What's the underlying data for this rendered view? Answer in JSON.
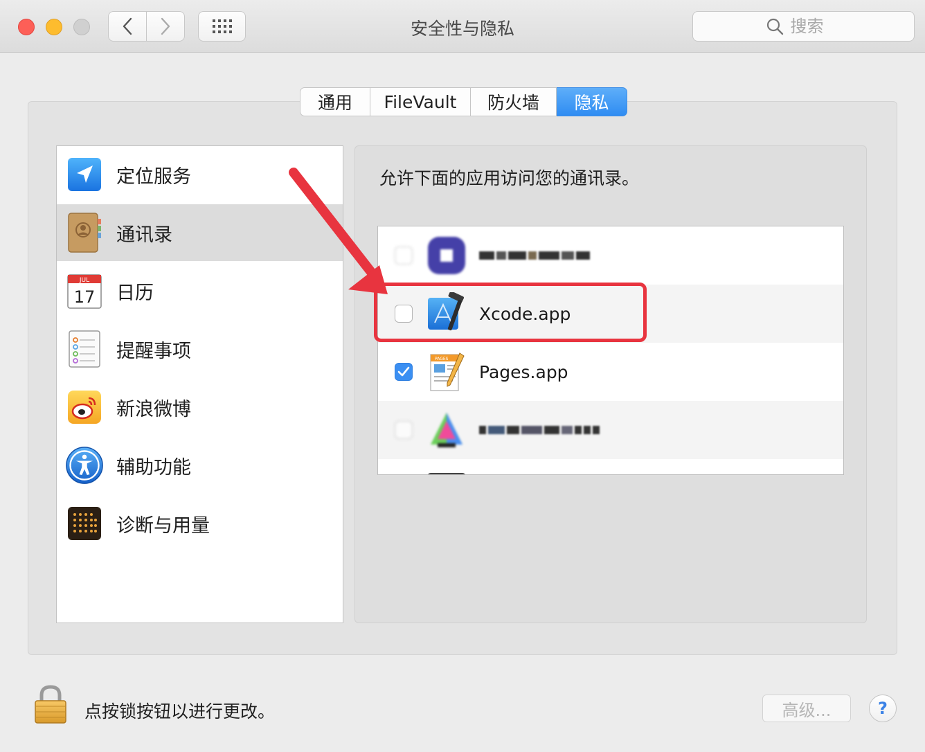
{
  "window": {
    "title": "安全性与隐私",
    "search_placeholder": "搜索"
  },
  "tabs": [
    {
      "label": "通用",
      "active": false
    },
    {
      "label": "FileVault",
      "active": false
    },
    {
      "label": "防火墙",
      "active": false
    },
    {
      "label": "隐私",
      "active": true
    }
  ],
  "sidebar": {
    "items": [
      {
        "label": "定位服务",
        "icon": "location-arrow-icon",
        "selected": false
      },
      {
        "label": "通讯录",
        "icon": "contacts-book-icon",
        "selected": true
      },
      {
        "label": "日历",
        "icon": "calendar-icon",
        "selected": false
      },
      {
        "label": "提醒事项",
        "icon": "reminders-icon",
        "selected": false
      },
      {
        "label": "新浪微博",
        "icon": "weibo-icon",
        "selected": false
      },
      {
        "label": "辅助功能",
        "icon": "accessibility-icon",
        "selected": false
      },
      {
        "label": "诊断与用量",
        "icon": "diagnostics-icon",
        "selected": false
      }
    ]
  },
  "main": {
    "instructions": "允许下面的应用访问您的通讯录。",
    "apps": [
      {
        "name": "",
        "checked": false,
        "obscured": true,
        "icon": "blurred-app-icon"
      },
      {
        "name": "Xcode.app",
        "checked": false,
        "obscured": false,
        "icon": "xcode-hammer-icon"
      },
      {
        "name": "Pages.app",
        "checked": true,
        "obscured": false,
        "icon": "pages-app-icon"
      },
      {
        "name": "",
        "checked": false,
        "obscured": true,
        "icon": "blurred-app-icon"
      }
    ]
  },
  "footer": {
    "lock_text": "点按锁按钮以进行更改。",
    "advanced_label": "高级...",
    "help_label": "?"
  },
  "colors": {
    "accent": "#3b8ff2",
    "highlight": "#e8343f"
  }
}
